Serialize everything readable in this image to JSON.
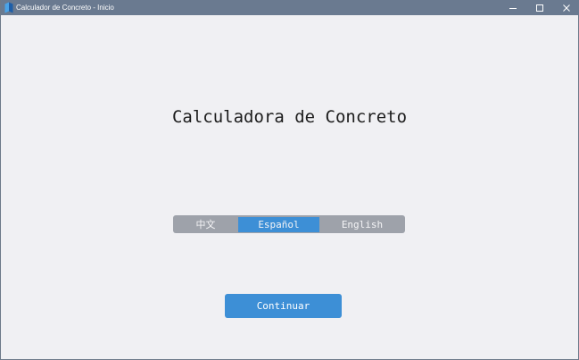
{
  "window": {
    "title": "Calculador de Concreto - Inicio"
  },
  "main": {
    "heading": "Calculadora de Concreto",
    "languages": [
      {
        "label": "中文",
        "selected": false
      },
      {
        "label": "Español",
        "selected": true
      },
      {
        "label": "English",
        "selected": false
      }
    ],
    "continue_label": "Continuar"
  },
  "colors": {
    "titlebar": "#6a7a90",
    "accent": "#3d8fd6",
    "language_bar": "#9ea2aa",
    "background": "#f0f0f3"
  },
  "icons": {
    "app": "app-icon",
    "minimize": "minimize-icon",
    "maximize": "maximize-icon",
    "close": "close-icon"
  }
}
